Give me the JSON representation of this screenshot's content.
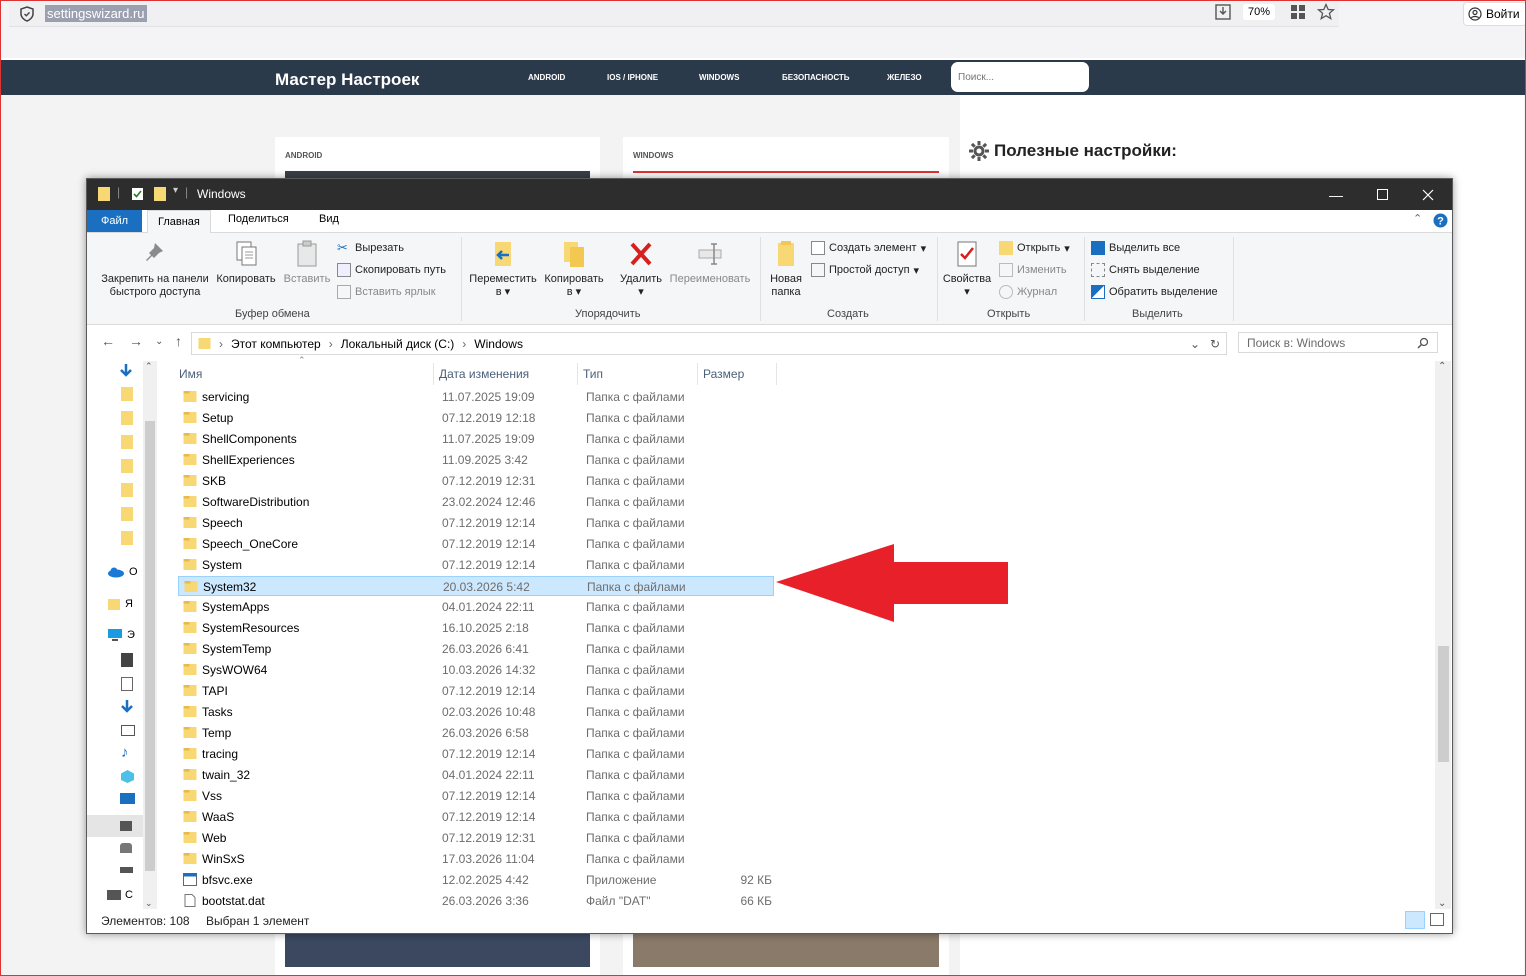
{
  "browser": {
    "url": "settingswizard.ru",
    "zoom": "70%",
    "login_label": "Войти"
  },
  "site": {
    "title": "Мастер Настроек",
    "nav": [
      "ANDROID",
      "IOS / IPHONE",
      "WINDOWS",
      "БЕЗОПАСНОСТЬ",
      "ЖЕЛЕЗО"
    ],
    "search_placeholder": "Поиск...",
    "card1_category": "ANDROID",
    "card2_category": "WINDOWS",
    "sidebar_title": "Полезные настройки:"
  },
  "explorer": {
    "title": "Windows",
    "tabs": {
      "file": "Файл",
      "home": "Главная",
      "share": "Поделиться",
      "view": "Вид"
    },
    "ribbon": {
      "pin": "Закрепить на панели быстрого доступа",
      "copy": "Копировать",
      "paste": "Вставить",
      "cut": "Вырезать",
      "copy_path": "Скопировать путь",
      "paste_shortcut": "Вставить ярлык",
      "group_clipboard": "Буфер обмена",
      "move_to": "Переместить в",
      "copy_to": "Копировать в",
      "delete": "Удалить",
      "rename": "Переименовать",
      "group_organize": "Упорядочить",
      "new_folder": "Новая папка",
      "new_item": "Создать элемент",
      "easy_access": "Простой доступ",
      "group_new": "Создать",
      "properties": "Свойства",
      "open": "Открыть",
      "edit": "Изменить",
      "history": "Журнал",
      "group_open": "Открыть",
      "select_all": "Выделить все",
      "select_none": "Снять выделение",
      "invert_selection": "Обратить выделение",
      "group_select": "Выделить"
    },
    "breadcrumb": [
      "Этот компьютер",
      "Локальный диск (C:)",
      "Windows"
    ],
    "search_placeholder": "Поиск в: Windows",
    "columns": {
      "name": "Имя",
      "date": "Дата изменения",
      "type": "Тип",
      "size": "Размер"
    },
    "nav_labels": [
      "O",
      "Я",
      "Э",
      "С"
    ],
    "rows": [
      {
        "name": "servicing",
        "date": "11.07.2025 19:09",
        "type": "Папка с файлами",
        "size": "",
        "kind": "folder"
      },
      {
        "name": "Setup",
        "date": "07.12.2019 12:18",
        "type": "Папка с файлами",
        "size": "",
        "kind": "folder"
      },
      {
        "name": "ShellComponents",
        "date": "11.07.2025 19:09",
        "type": "Папка с файлами",
        "size": "",
        "kind": "folder"
      },
      {
        "name": "ShellExperiences",
        "date": "11.09.2025 3:42",
        "type": "Папка с файлами",
        "size": "",
        "kind": "folder"
      },
      {
        "name": "SKB",
        "date": "07.12.2019 12:31",
        "type": "Папка с файлами",
        "size": "",
        "kind": "folder"
      },
      {
        "name": "SoftwareDistribution",
        "date": "23.02.2024 12:46",
        "type": "Папка с файлами",
        "size": "",
        "kind": "folder"
      },
      {
        "name": "Speech",
        "date": "07.12.2019 12:14",
        "type": "Папка с файлами",
        "size": "",
        "kind": "folder"
      },
      {
        "name": "Speech_OneCore",
        "date": "07.12.2019 12:14",
        "type": "Папка с файлами",
        "size": "",
        "kind": "folder"
      },
      {
        "name": "System",
        "date": "07.12.2019 12:14",
        "type": "Папка с файлами",
        "size": "",
        "kind": "folder"
      },
      {
        "name": "System32",
        "date": "20.03.2026 5:42",
        "type": "Папка с файлами",
        "size": "",
        "kind": "folder",
        "selected": true
      },
      {
        "name": "SystemApps",
        "date": "04.01.2024 22:11",
        "type": "Папка с файлами",
        "size": "",
        "kind": "folder"
      },
      {
        "name": "SystemResources",
        "date": "16.10.2025 2:18",
        "type": "Папка с файлами",
        "size": "",
        "kind": "folder"
      },
      {
        "name": "SystemTemp",
        "date": "26.03.2026 6:41",
        "type": "Папка с файлами",
        "size": "",
        "kind": "folder"
      },
      {
        "name": "SysWOW64",
        "date": "10.03.2026 14:32",
        "type": "Папка с файлами",
        "size": "",
        "kind": "folder"
      },
      {
        "name": "TAPI",
        "date": "07.12.2019 12:14",
        "type": "Папка с файлами",
        "size": "",
        "kind": "folder"
      },
      {
        "name": "Tasks",
        "date": "02.03.2026 10:48",
        "type": "Папка с файлами",
        "size": "",
        "kind": "folder"
      },
      {
        "name": "Temp",
        "date": "26.03.2026 6:58",
        "type": "Папка с файлами",
        "size": "",
        "kind": "folder"
      },
      {
        "name": "tracing",
        "date": "07.12.2019 12:14",
        "type": "Папка с файлами",
        "size": "",
        "kind": "folder"
      },
      {
        "name": "twain_32",
        "date": "04.01.2024 22:11",
        "type": "Папка с файлами",
        "size": "",
        "kind": "folder"
      },
      {
        "name": "Vss",
        "date": "07.12.2019 12:14",
        "type": "Папка с файлами",
        "size": "",
        "kind": "folder"
      },
      {
        "name": "WaaS",
        "date": "07.12.2019 12:14",
        "type": "Папка с файлами",
        "size": "",
        "kind": "folder"
      },
      {
        "name": "Web",
        "date": "07.12.2019 12:31",
        "type": "Папка с файлами",
        "size": "",
        "kind": "folder"
      },
      {
        "name": "WinSxS",
        "date": "17.03.2026 11:04",
        "type": "Папка с файлами",
        "size": "",
        "kind": "folder"
      },
      {
        "name": "bfsvc.exe",
        "date": "12.02.2025 4:42",
        "type": "Приложение",
        "size": "92 КБ",
        "kind": "exe"
      },
      {
        "name": "bootstat.dat",
        "date": "26.03.2026 3:36",
        "type": "Файл \"DAT\"",
        "size": "66 КБ",
        "kind": "file"
      }
    ],
    "status": {
      "count": "Элементов: 108",
      "selected": "Выбран 1 элемент"
    }
  },
  "colors": {
    "accent": "#1a6fc0",
    "selection": "#cce8ff",
    "arrow": "#e8202a",
    "site_header": "#2b3a4a"
  },
  "annotation": {
    "type": "red-arrow",
    "points_to": "System32"
  }
}
